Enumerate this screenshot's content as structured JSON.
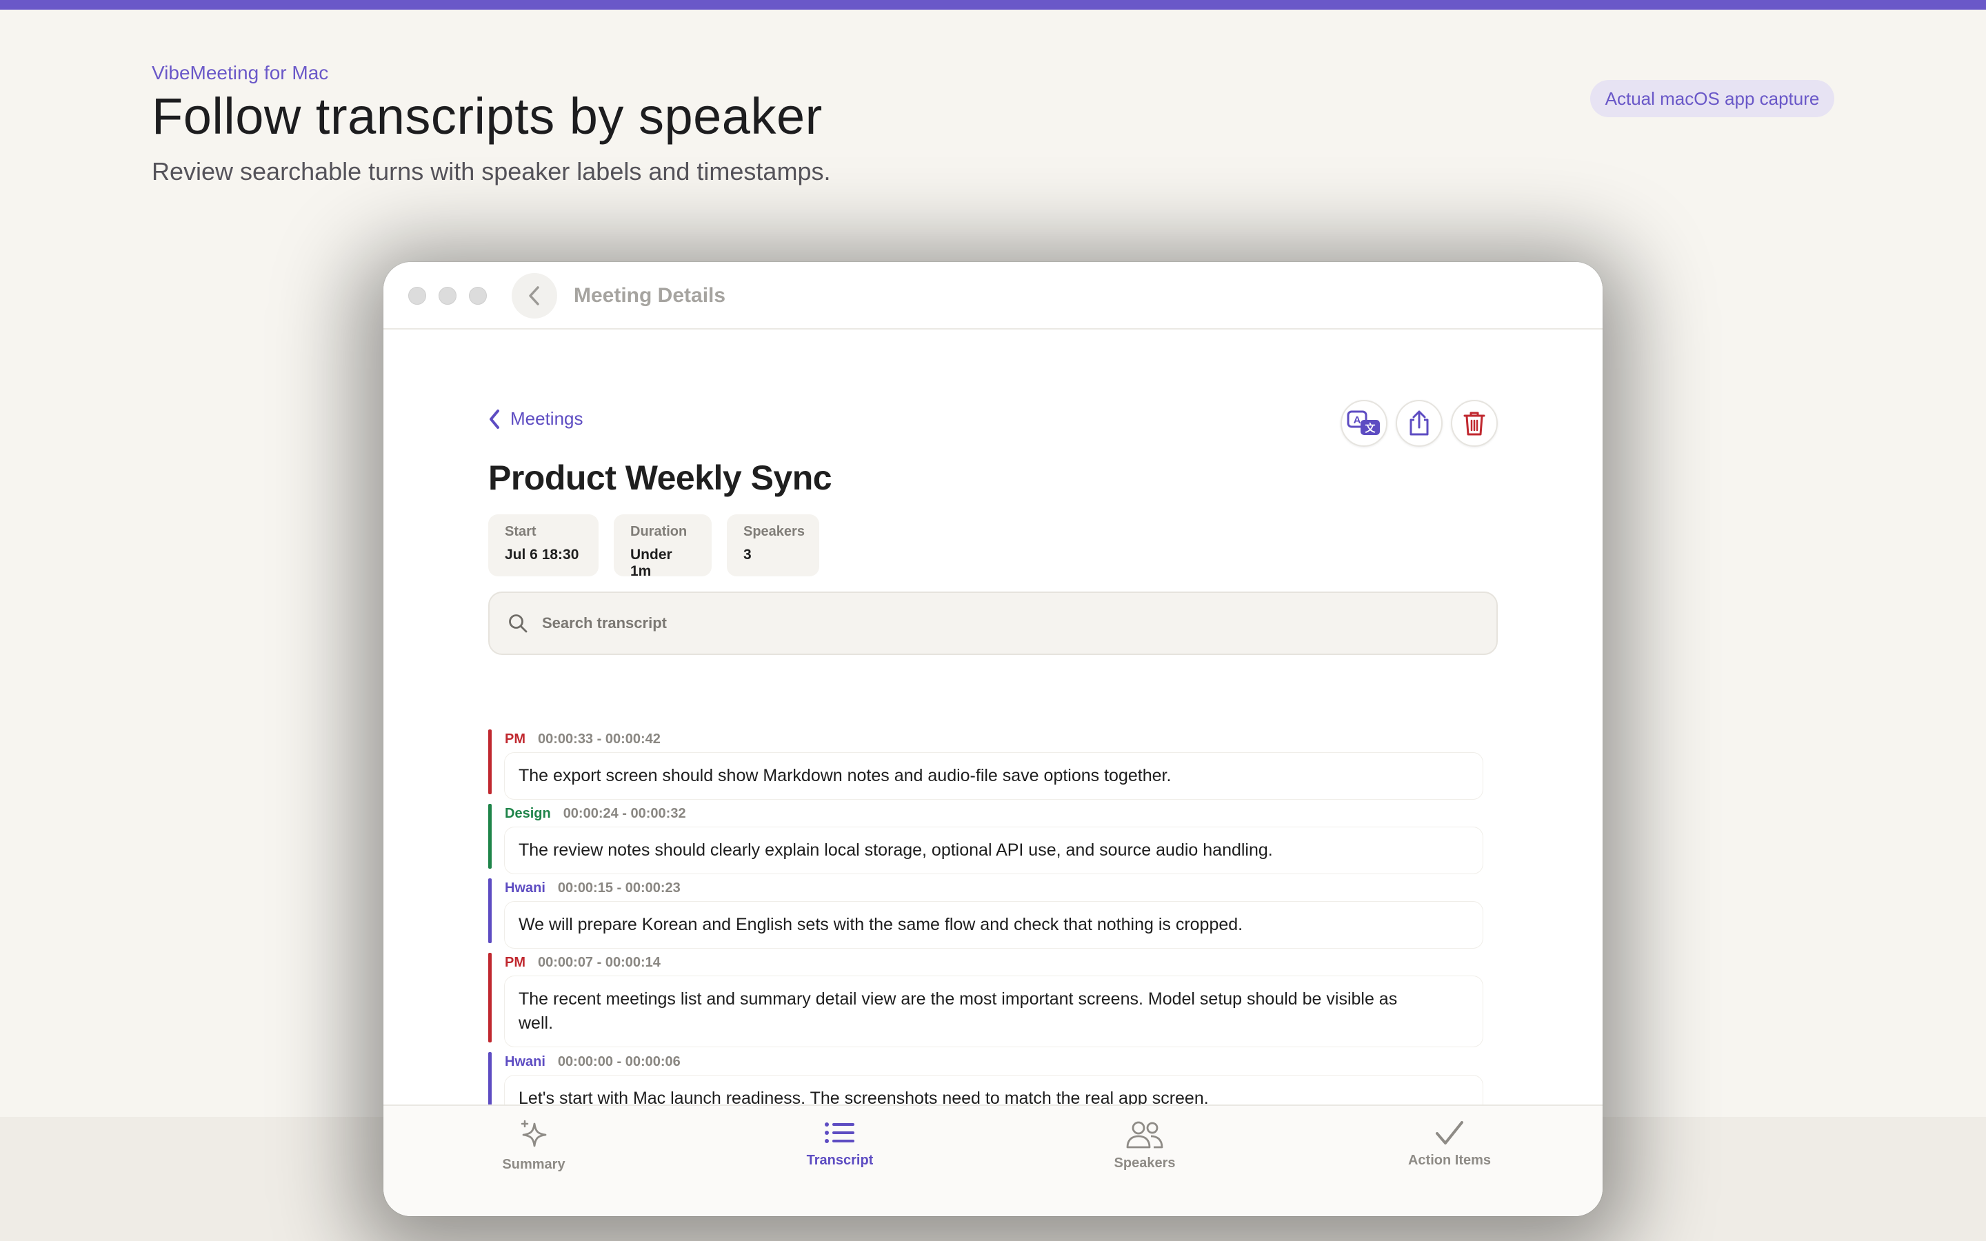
{
  "header": {
    "eyebrow": "VibeMeeting for Mac",
    "title": "Follow transcripts by speaker",
    "subtitle": "Review searchable turns with speaker labels and timestamps.",
    "badge": "Actual macOS app capture"
  },
  "window": {
    "title": "Meeting Details"
  },
  "meeting": {
    "back_label": "Meetings",
    "title": "Product Weekly Sync",
    "stats": [
      {
        "label": "Start",
        "value": "Jul 6 18:30"
      },
      {
        "label": "Duration",
        "value": "Under 1m"
      },
      {
        "label": "Speakers",
        "value": "3"
      }
    ]
  },
  "search": {
    "placeholder": "Search transcript",
    "value": ""
  },
  "speaker_colors": {
    "PM": "#c0282f",
    "Design": "#1e8449",
    "Hwani": "#5d4cc2"
  },
  "turns": [
    {
      "speaker": "PM",
      "time": "00:00:33 - 00:00:42",
      "text": "The export screen should show Markdown notes and audio-file save options together."
    },
    {
      "speaker": "Design",
      "time": "00:00:24 - 00:00:32",
      "text": "The review notes should clearly explain local storage, optional API use, and source audio handling."
    },
    {
      "speaker": "Hwani",
      "time": "00:00:15 - 00:00:23",
      "text": "We will prepare Korean and English sets with the same flow and check that nothing is cropped."
    },
    {
      "speaker": "PM",
      "time": "00:00:07 - 00:00:14",
      "text": "The recent meetings list and summary detail view are the most important screens. Model setup should be visible as well."
    },
    {
      "speaker": "Hwani",
      "time": "00:00:00 - 00:00:06",
      "text": "Let's start with Mac launch readiness. The screenshots need to match the real app screen."
    }
  ],
  "tabs": [
    {
      "label": "Summary",
      "icon": "sparkle-icon",
      "active": false
    },
    {
      "label": "Transcript",
      "icon": "list-icon",
      "active": true
    },
    {
      "label": "Speakers",
      "icon": "people-icon",
      "active": false
    },
    {
      "label": "Action Items",
      "icon": "checkmark-icon",
      "active": false
    }
  ],
  "accent_color": "#6a58c8"
}
